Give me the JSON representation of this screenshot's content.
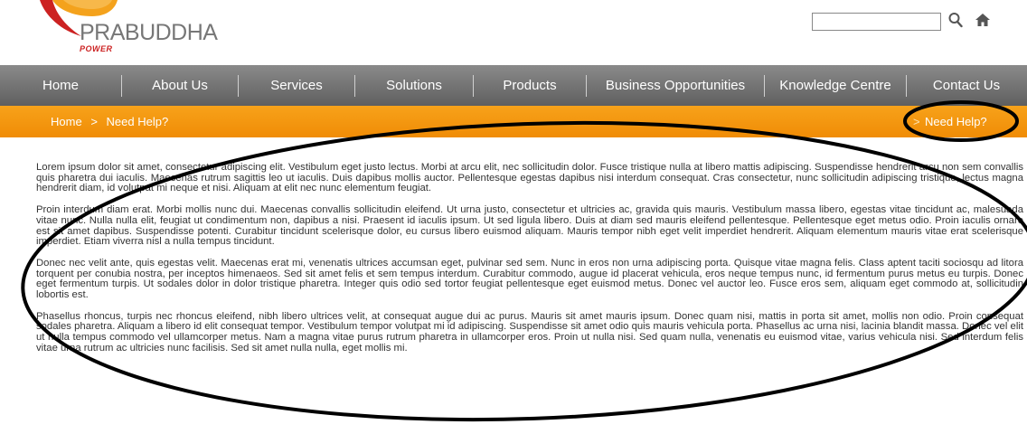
{
  "brand": {
    "name": "PRABUDDHA",
    "tagline": "POWER",
    "colors": {
      "accent": "#f39a10",
      "nav": "#6e6e6e",
      "logo_red": "#cc2222",
      "logo_orange": "#f4a21c"
    }
  },
  "header": {
    "search_placeholder": "",
    "icons": [
      "search-icon",
      "home-icon"
    ]
  },
  "nav": {
    "items": [
      {
        "label": "Home"
      },
      {
        "label": "About Us"
      },
      {
        "label": "Services"
      },
      {
        "label": "Solutions"
      },
      {
        "label": "Products"
      },
      {
        "label": "Business Opportunities"
      },
      {
        "label": "Knowledge Centre"
      },
      {
        "label": "Contact Us"
      }
    ]
  },
  "breadcrumb": {
    "home": "Home",
    "separator": ">",
    "current": "Need Help?",
    "right_label": "Need Help?"
  },
  "content": {
    "paragraphs": [
      "Lorem ipsum dolor sit amet, consectetur adipiscing elit. Vestibulum eget justo lectus. Morbi at arcu elit, nec sollicitudin dolor. Fusce tristique nulla at libero mattis adipiscing. Suspendisse hendrerit arcu non sem convallis quis pharetra dui iaculis. Maecenas rutrum sagittis leo ut iaculis. Duis dapibus mollis auctor. Pellentesque egestas dapibus nisi interdum consequat. Cras consectetur, nunc sollicitudin adipiscing tristique, lectus magna hendrerit diam, id volutpat mi neque et nisi. Aliquam at elit nec nunc elementum feugiat.",
      "Proin interdum diam erat. Morbi mollis nunc dui. Maecenas convallis sollicitudin eleifend. Ut urna justo, consectetur et ultricies ac, gravida quis mauris. Vestibulum massa libero, egestas vitae tincidunt ac, malesuada vitae nunc. Nulla nulla elit, feugiat ut condimentum non, dapibus a nisi. Praesent id iaculis ipsum. Ut sed ligula libero. Duis at diam sed mauris eleifend pellentesque. Pellentesque eget metus odio. Proin iaculis ornare est sit amet dapibus. Suspendisse potenti. Curabitur tincidunt scelerisque dolor, eu cursus libero euismod aliquam. Mauris tempor nibh eget velit imperdiet hendrerit. Aliquam elementum mauris vitae erat scelerisque imperdiet. Etiam viverra nisl a nulla tempus tincidunt.",
      "Donec nec velit ante, quis egestas velit. Maecenas erat mi, venenatis ultrices accumsan eget, pulvinar sed sem. Nunc in eros non urna adipiscing porta. Quisque vitae magna felis. Class aptent taciti sociosqu ad litora torquent per conubia nostra, per inceptos himenaeos. Sed sit amet felis et sem tempus interdum. Curabitur commodo, augue id placerat vehicula, eros neque tempus nunc, id fermentum purus metus eu turpis. Donec eget fermentum turpis. Ut sodales dolor in dolor tristique pharetra. Integer quis odio sed tortor feugiat pellentesque eget euismod metus. Donec vel auctor leo. Fusce eros sem, aliquam eget commodo at, sollicitudin lobortis est.",
      "Phasellus rhoncus, turpis nec rhoncus eleifend, nibh libero ultrices velit, at consequat augue dui ac purus. Mauris sit amet mauris ipsum. Donec quam nisi, mattis in porta sit amet, mollis non odio. Proin consequat sodales pharetra. Aliquam a libero id elit consequat tempor. Vestibulum tempor volutpat mi id adipiscing. Suspendisse sit amet odio quis mauris vehicula porta. Phasellus ac urna nisi, lacinia blandit massa. Donec vel elit ut nulla tempus commodo vel ullamcorper metus. Nam a magna vitae purus rutrum pharetra in ullamcorper eros. Proin ut nulla nisi. Sed quam nulla, venenatis eu euismod vitae, varius vehicula nisi. Sed interdum felis vitae urna rutrum ac ultricies nunc facilisis. Sed sit amet nulla nulla, eget mollis mi."
    ]
  }
}
